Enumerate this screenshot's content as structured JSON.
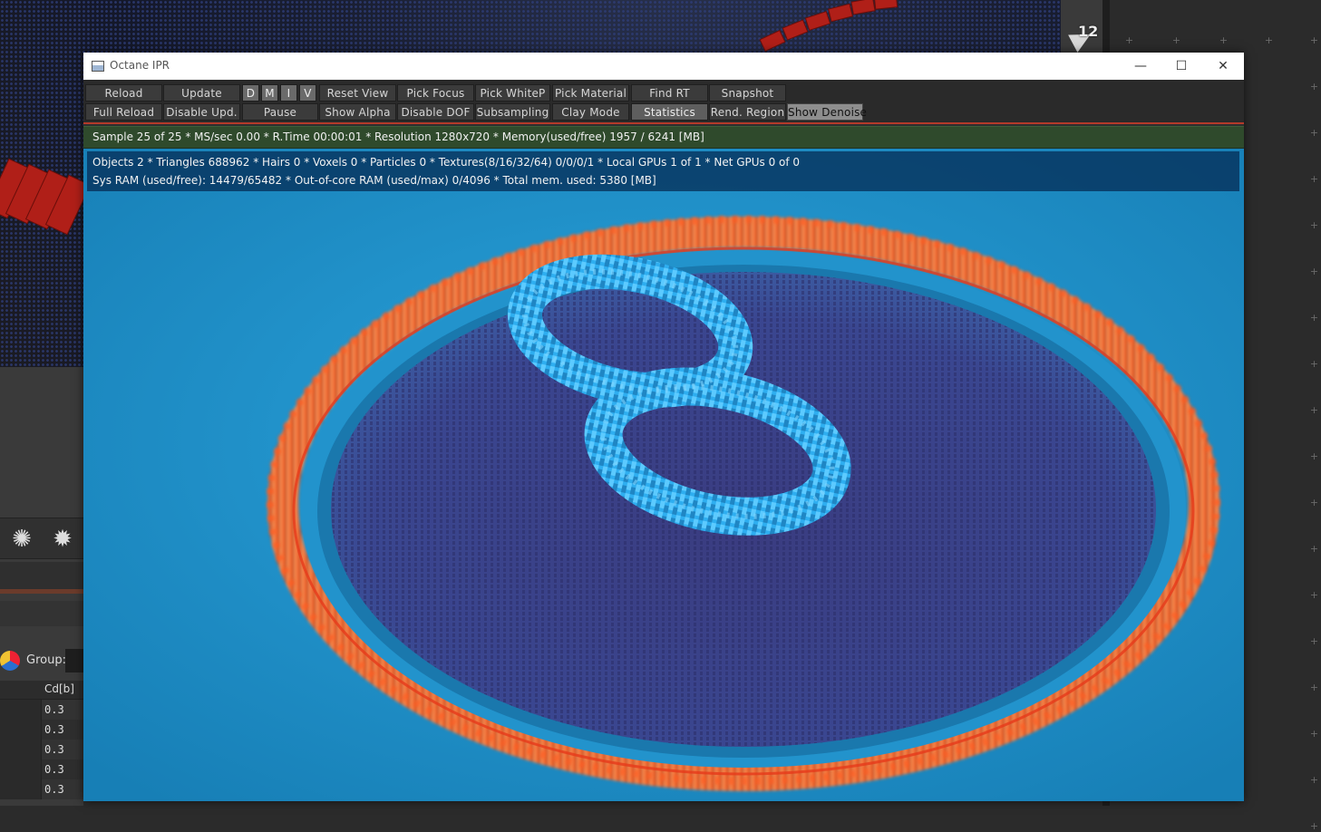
{
  "background_app": {
    "viewport_badge": "12",
    "group_label": "Group:",
    "attr_table": {
      "column_header": "Cd[b]",
      "values": [
        "0.3",
        "0.3",
        "0.3",
        "0.3",
        "0.3"
      ]
    }
  },
  "window": {
    "title": "Octane IPR",
    "controls": {
      "minimize": "—",
      "maximize": "☐",
      "close": "✕"
    }
  },
  "toolbar": {
    "row1": {
      "reload": "Reload",
      "update": "Update",
      "d": "D",
      "m": "M",
      "i": "I",
      "v": "V",
      "reset_view": "Reset View",
      "pick_focus": "Pick Focus",
      "pick_whitep": "Pick WhiteP",
      "pick_material": "Pick Material",
      "find_rt": "Find RT",
      "snapshot": "Snapshot"
    },
    "row2": {
      "full_reload": "Full Reload",
      "disable_upd": "Disable Upd.",
      "pause": "Pause",
      "show_alpha": "Show Alpha",
      "disable_dof": "Disable DOF",
      "subsampling": "Subsampling",
      "clay_mode": "Clay Mode",
      "statistics": "Statistics",
      "rend_region": "Rend. Region",
      "show_denoise": "Show Denoise"
    }
  },
  "status_bar": "Sample 25 of 25 * MS/sec 0.00 * R.Time 00:00:01 * Resolution 1280x720 * Memory(used/free) 1957 / 6241 [MB]",
  "stats": {
    "line1": "Objects 2 * Triangles 688962 * Hairs 0 * Voxels 0 * Particles 0 * Textures(8/16/32/64) 0/0/0/1 * Local GPUs 1 of 1 * Net GPUs 0 of 0",
    "line2": "Sys RAM (used/free): 14479/65482 * Out-of-core RAM (used/max) 0/4096 * Total mem. used: 5380 [MB]"
  },
  "colors": {
    "render_background": "#1e93cc",
    "status_green": "#2f4a2c",
    "ring_orange": "#ff6a2a",
    "disc_purple": "#3a3f86",
    "figure_eight_blue": "#2aa6e8"
  }
}
